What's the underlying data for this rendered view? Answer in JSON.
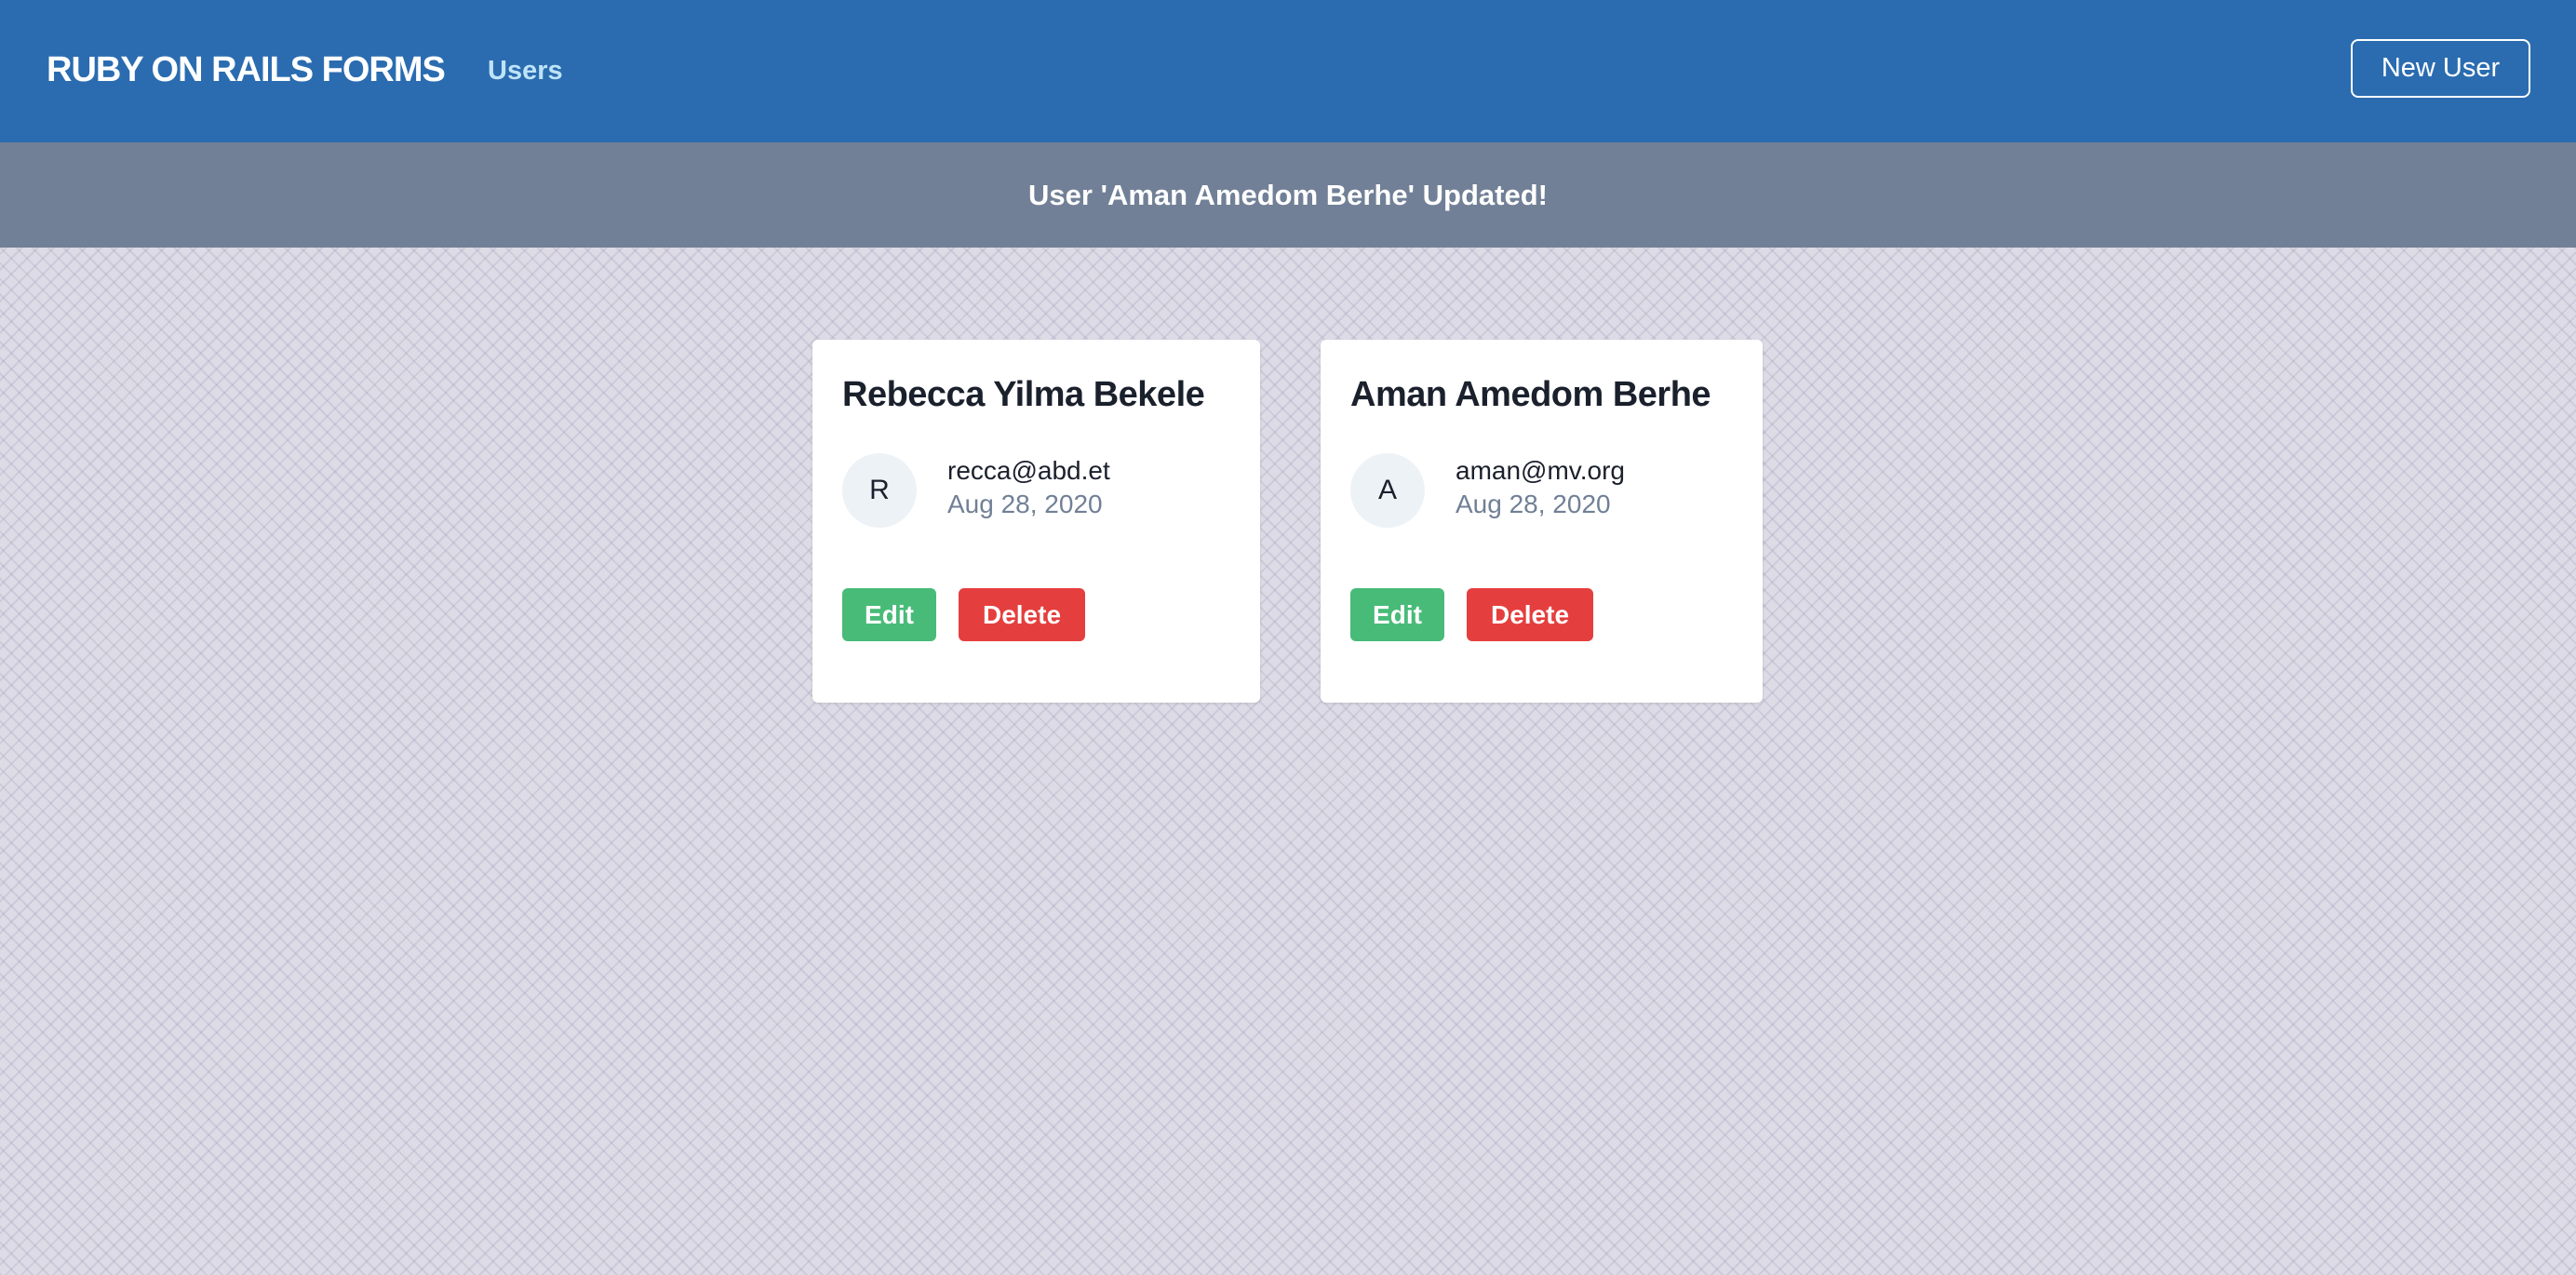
{
  "navbar": {
    "brand": "RUBY ON RAILS FORMS",
    "nav_link": "Users",
    "new_user_label": "New User"
  },
  "flash": {
    "message": "User 'Aman Amedom Berhe' Updated!"
  },
  "users": [
    {
      "name": "Rebecca Yilma Bekele",
      "initial": "R",
      "email": "recca@abd.et",
      "date": "Aug 28, 2020",
      "edit_label": "Edit",
      "delete_label": "Delete"
    },
    {
      "name": "Aman Amedom Berhe",
      "initial": "A",
      "email": "aman@mv.org",
      "date": "Aug 28, 2020",
      "edit_label": "Edit",
      "delete_label": "Delete"
    }
  ],
  "colors": {
    "navbar": "#2b6cb0",
    "flash": "#718096",
    "edit": "#48bb78",
    "delete": "#e53e3e"
  }
}
